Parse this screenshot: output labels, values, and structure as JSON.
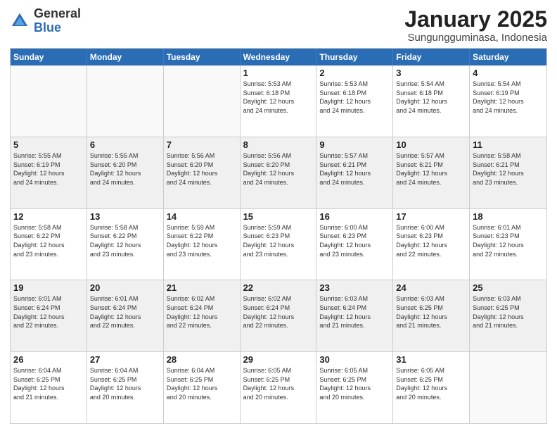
{
  "logo": {
    "general": "General",
    "blue": "Blue"
  },
  "title": "January 2025",
  "subtitle": "Sungungguminasa, Indonesia",
  "days": [
    "Sunday",
    "Monday",
    "Tuesday",
    "Wednesday",
    "Thursday",
    "Friday",
    "Saturday"
  ],
  "weeks": [
    [
      {
        "day": "",
        "info": ""
      },
      {
        "day": "",
        "info": ""
      },
      {
        "day": "",
        "info": ""
      },
      {
        "day": "1",
        "info": "Sunrise: 5:53 AM\nSunset: 6:18 PM\nDaylight: 12 hours\nand 24 minutes."
      },
      {
        "day": "2",
        "info": "Sunrise: 5:53 AM\nSunset: 6:18 PM\nDaylight: 12 hours\nand 24 minutes."
      },
      {
        "day": "3",
        "info": "Sunrise: 5:54 AM\nSunset: 6:18 PM\nDaylight: 12 hours\nand 24 minutes."
      },
      {
        "day": "4",
        "info": "Sunrise: 5:54 AM\nSunset: 6:19 PM\nDaylight: 12 hours\nand 24 minutes."
      }
    ],
    [
      {
        "day": "5",
        "info": "Sunrise: 5:55 AM\nSunset: 6:19 PM\nDaylight: 12 hours\nand 24 minutes."
      },
      {
        "day": "6",
        "info": "Sunrise: 5:55 AM\nSunset: 6:20 PM\nDaylight: 12 hours\nand 24 minutes."
      },
      {
        "day": "7",
        "info": "Sunrise: 5:56 AM\nSunset: 6:20 PM\nDaylight: 12 hours\nand 24 minutes."
      },
      {
        "day": "8",
        "info": "Sunrise: 5:56 AM\nSunset: 6:20 PM\nDaylight: 12 hours\nand 24 minutes."
      },
      {
        "day": "9",
        "info": "Sunrise: 5:57 AM\nSunset: 6:21 PM\nDaylight: 12 hours\nand 24 minutes."
      },
      {
        "day": "10",
        "info": "Sunrise: 5:57 AM\nSunset: 6:21 PM\nDaylight: 12 hours\nand 24 minutes."
      },
      {
        "day": "11",
        "info": "Sunrise: 5:58 AM\nSunset: 6:21 PM\nDaylight: 12 hours\nand 23 minutes."
      }
    ],
    [
      {
        "day": "12",
        "info": "Sunrise: 5:58 AM\nSunset: 6:22 PM\nDaylight: 12 hours\nand 23 minutes."
      },
      {
        "day": "13",
        "info": "Sunrise: 5:58 AM\nSunset: 6:22 PM\nDaylight: 12 hours\nand 23 minutes."
      },
      {
        "day": "14",
        "info": "Sunrise: 5:59 AM\nSunset: 6:22 PM\nDaylight: 12 hours\nand 23 minutes."
      },
      {
        "day": "15",
        "info": "Sunrise: 5:59 AM\nSunset: 6:23 PM\nDaylight: 12 hours\nand 23 minutes."
      },
      {
        "day": "16",
        "info": "Sunrise: 6:00 AM\nSunset: 6:23 PM\nDaylight: 12 hours\nand 23 minutes."
      },
      {
        "day": "17",
        "info": "Sunrise: 6:00 AM\nSunset: 6:23 PM\nDaylight: 12 hours\nand 22 minutes."
      },
      {
        "day": "18",
        "info": "Sunrise: 6:01 AM\nSunset: 6:23 PM\nDaylight: 12 hours\nand 22 minutes."
      }
    ],
    [
      {
        "day": "19",
        "info": "Sunrise: 6:01 AM\nSunset: 6:24 PM\nDaylight: 12 hours\nand 22 minutes."
      },
      {
        "day": "20",
        "info": "Sunrise: 6:01 AM\nSunset: 6:24 PM\nDaylight: 12 hours\nand 22 minutes."
      },
      {
        "day": "21",
        "info": "Sunrise: 6:02 AM\nSunset: 6:24 PM\nDaylight: 12 hours\nand 22 minutes."
      },
      {
        "day": "22",
        "info": "Sunrise: 6:02 AM\nSunset: 6:24 PM\nDaylight: 12 hours\nand 22 minutes."
      },
      {
        "day": "23",
        "info": "Sunrise: 6:03 AM\nSunset: 6:24 PM\nDaylight: 12 hours\nand 21 minutes."
      },
      {
        "day": "24",
        "info": "Sunrise: 6:03 AM\nSunset: 6:25 PM\nDaylight: 12 hours\nand 21 minutes."
      },
      {
        "day": "25",
        "info": "Sunrise: 6:03 AM\nSunset: 6:25 PM\nDaylight: 12 hours\nand 21 minutes."
      }
    ],
    [
      {
        "day": "26",
        "info": "Sunrise: 6:04 AM\nSunset: 6:25 PM\nDaylight: 12 hours\nand 21 minutes."
      },
      {
        "day": "27",
        "info": "Sunrise: 6:04 AM\nSunset: 6:25 PM\nDaylight: 12 hours\nand 20 minutes."
      },
      {
        "day": "28",
        "info": "Sunrise: 6:04 AM\nSunset: 6:25 PM\nDaylight: 12 hours\nand 20 minutes."
      },
      {
        "day": "29",
        "info": "Sunrise: 6:05 AM\nSunset: 6:25 PM\nDaylight: 12 hours\nand 20 minutes."
      },
      {
        "day": "30",
        "info": "Sunrise: 6:05 AM\nSunset: 6:25 PM\nDaylight: 12 hours\nand 20 minutes."
      },
      {
        "day": "31",
        "info": "Sunrise: 6:05 AM\nSunset: 6:25 PM\nDaylight: 12 hours\nand 20 minutes."
      },
      {
        "day": "",
        "info": ""
      }
    ]
  ]
}
